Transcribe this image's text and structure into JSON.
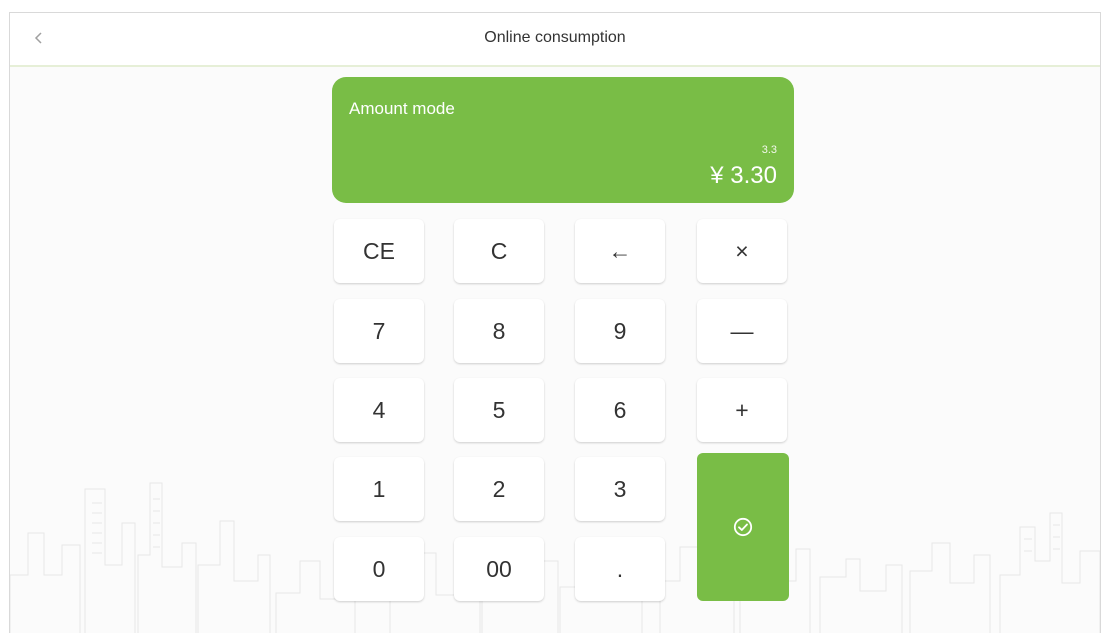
{
  "header": {
    "title": "Online consumption"
  },
  "display": {
    "mode": "Amount mode",
    "raw_value": "3.3",
    "amount": "¥ 3.30",
    "accent": "#79bd46"
  },
  "keypad": {
    "row1": [
      "CE",
      "C",
      "←",
      "×"
    ],
    "row2": [
      "7",
      "8",
      "9",
      "—"
    ],
    "row3": [
      "4",
      "5",
      "6",
      "+"
    ],
    "row4": [
      "1",
      "2",
      "3"
    ],
    "row5": [
      "0",
      "00",
      "."
    ]
  },
  "icons": {
    "back": "chevron-left-icon",
    "confirm": "check-circle-icon"
  }
}
